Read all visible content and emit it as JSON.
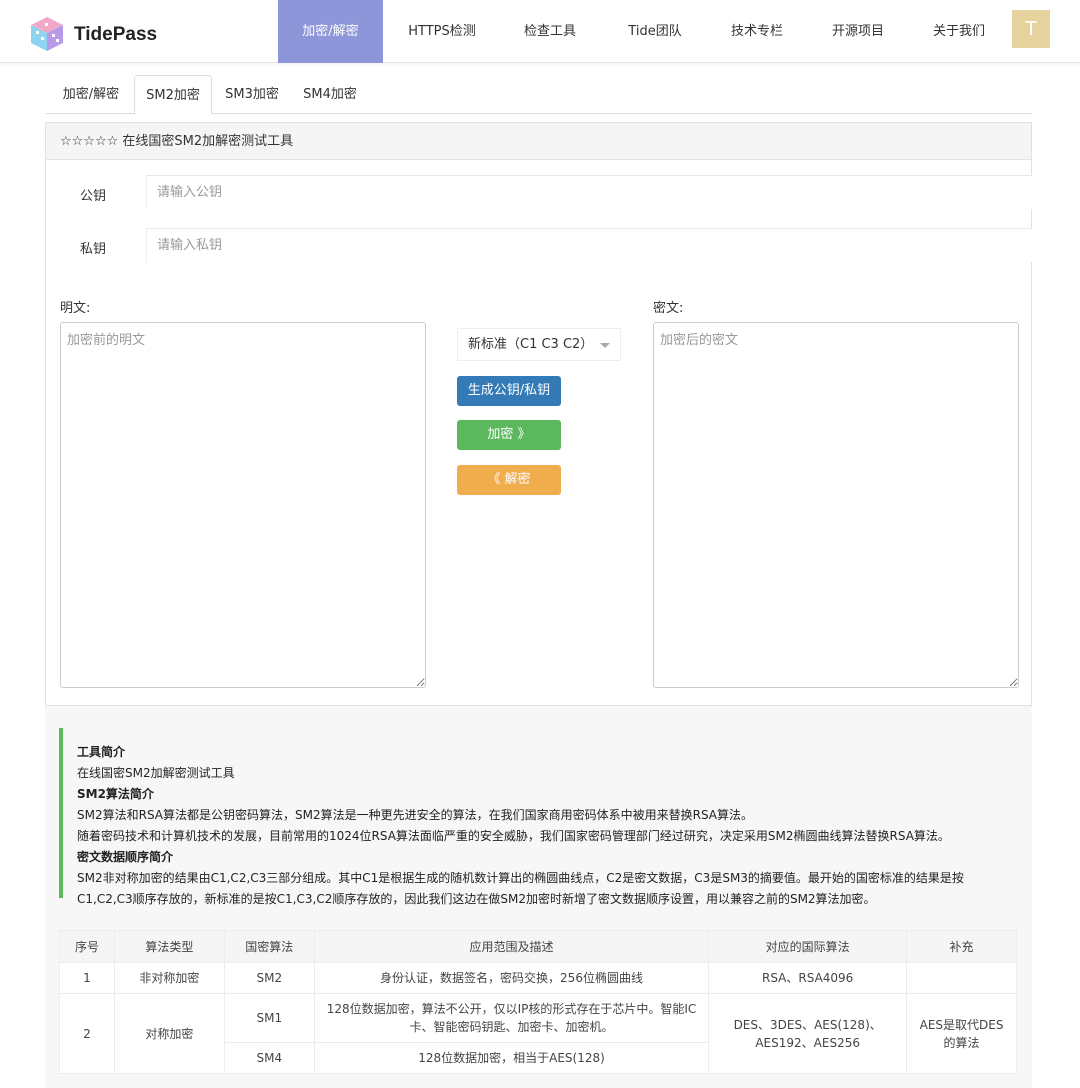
{
  "header": {
    "brand": "TidePass",
    "nav": [
      "加密/解密",
      "HTTPS检测",
      "检查工具",
      "Tide团队",
      "技术专栏",
      "开源项目",
      "关于我们"
    ],
    "active_nav": "加密/解密",
    "avatar_letter": "T",
    "colors": {
      "active": "#8d96d9",
      "avatar": "#e5d29c"
    }
  },
  "tabs": [
    "加密/解密",
    "SM2加密",
    "SM3加密",
    "SM4加密"
  ],
  "active_tab": "SM2加密",
  "panel": {
    "title": "☆☆☆☆☆ 在线国密SM2加解密测试工具",
    "public_key_label": "公钥",
    "public_key_placeholder": "请输入公钥",
    "private_key_label": "私钥",
    "private_key_placeholder": "请输入私钥",
    "plaintext_label": "明文:",
    "plaintext_placeholder": "加密前的明文",
    "ciphertext_label": "密文:",
    "ciphertext_placeholder": "加密后的密文",
    "mode_select": "新标准（C1 C3 C2）",
    "gen_button": "生成公钥/私钥",
    "encrypt_button": "加密 》",
    "decrypt_button": "《 解密",
    "colors": {
      "gen": "#337ab7",
      "encrypt": "#5cb85c",
      "decrypt": "#f0ad4e"
    }
  },
  "intro": {
    "h1": "工具简介",
    "p1": "在线国密SM2加解密测试工具",
    "h2": "SM2算法简介",
    "p2a": "SM2算法和RSA算法都是公钥密码算法，SM2算法是一种更先进安全的算法，在我们国家商用密码体系中被用来替换RSA算法。",
    "p2b": "随着密码技术和计算机技术的发展，目前常用的1024位RSA算法面临严重的安全威胁，我们国家密码管理部门经过研究，决定采用SM2椭圆曲线算法替换RSA算法。",
    "h3": "密文数据顺序简介",
    "p3": "SM2非对称加密的结果由C1,C2,C3三部分组成。其中C1是根据生成的随机数计算出的椭圆曲线点，C2是密文数据，C3是SM3的摘要值。最开始的国密标准的结果是按C1,C2,C3顺序存放的，新标准的是按C1,C3,C2顺序存放的，因此我们这边在做SM2加密时新增了密文数据顺序设置，用以兼容之前的SM2算法加密。"
  },
  "table": {
    "headers": [
      "序号",
      "算法类型",
      "国密算法",
      "应用范围及描述",
      "对应的国际算法",
      "补充"
    ],
    "row1": {
      "no": "1",
      "type": "非对称加密",
      "alg": "SM2",
      "desc": "身份认证，数据签名，密码交换，256位椭圆曲线",
      "intl": "RSA、RSA4096",
      "note": ""
    },
    "row2": {
      "no": "2",
      "type": "对称加密",
      "alg": "SM1",
      "desc": "128位数据加密，算法不公开，仅以IP核的形式存在于芯片中。智能IC卡、智能密码钥匙、加密卡、加密机。",
      "intl": "DES、3DES、AES(128)、AES192、AES256",
      "note": "AES是取代DES的算法"
    },
    "row3": {
      "alg": "SM4",
      "desc": "128位数据加密，相当于AES(128)"
    }
  }
}
